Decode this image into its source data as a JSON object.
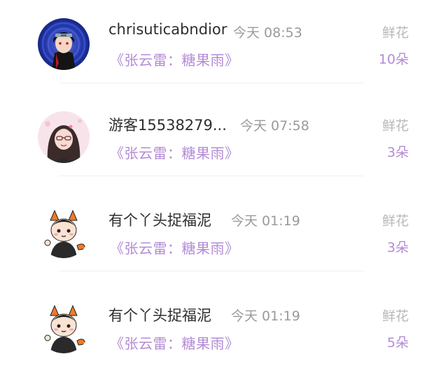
{
  "gift_records": [
    {
      "avatar_icon": "anime-ninja-avatar-icon",
      "username": "chrisuticabndior",
      "time": "今天 08:53",
      "song": "《张云雷：糖果雨》",
      "gift_type": "鲜花",
      "gift_count": "10朵"
    },
    {
      "avatar_icon": "woman-portrait-avatar-icon",
      "username": "游客15538279...",
      "time": "今天 07:58",
      "song": "《张云雷：糖果雨》",
      "gift_type": "鲜花",
      "gift_count": "3朵"
    },
    {
      "avatar_icon": "cartoon-fox-boy-avatar-icon",
      "username": "有个丫头捉福泥",
      "time": "今天 01:19",
      "song": "《张云雷：糖果雨》",
      "gift_type": "鲜花",
      "gift_count": "3朵"
    },
    {
      "avatar_icon": "cartoon-fox-boy-avatar-icon",
      "username": "有个丫头捉福泥",
      "time": "今天 01:19",
      "song": "《张云雷：糖果雨》",
      "gift_type": "鲜花",
      "gift_count": "5朵"
    }
  ],
  "colors": {
    "background": "#ffffff",
    "username": "#2e2e2e",
    "time": "#9a9a9a",
    "accent_purple": "#b38bd6",
    "gift_label": "#b8b8b8"
  }
}
